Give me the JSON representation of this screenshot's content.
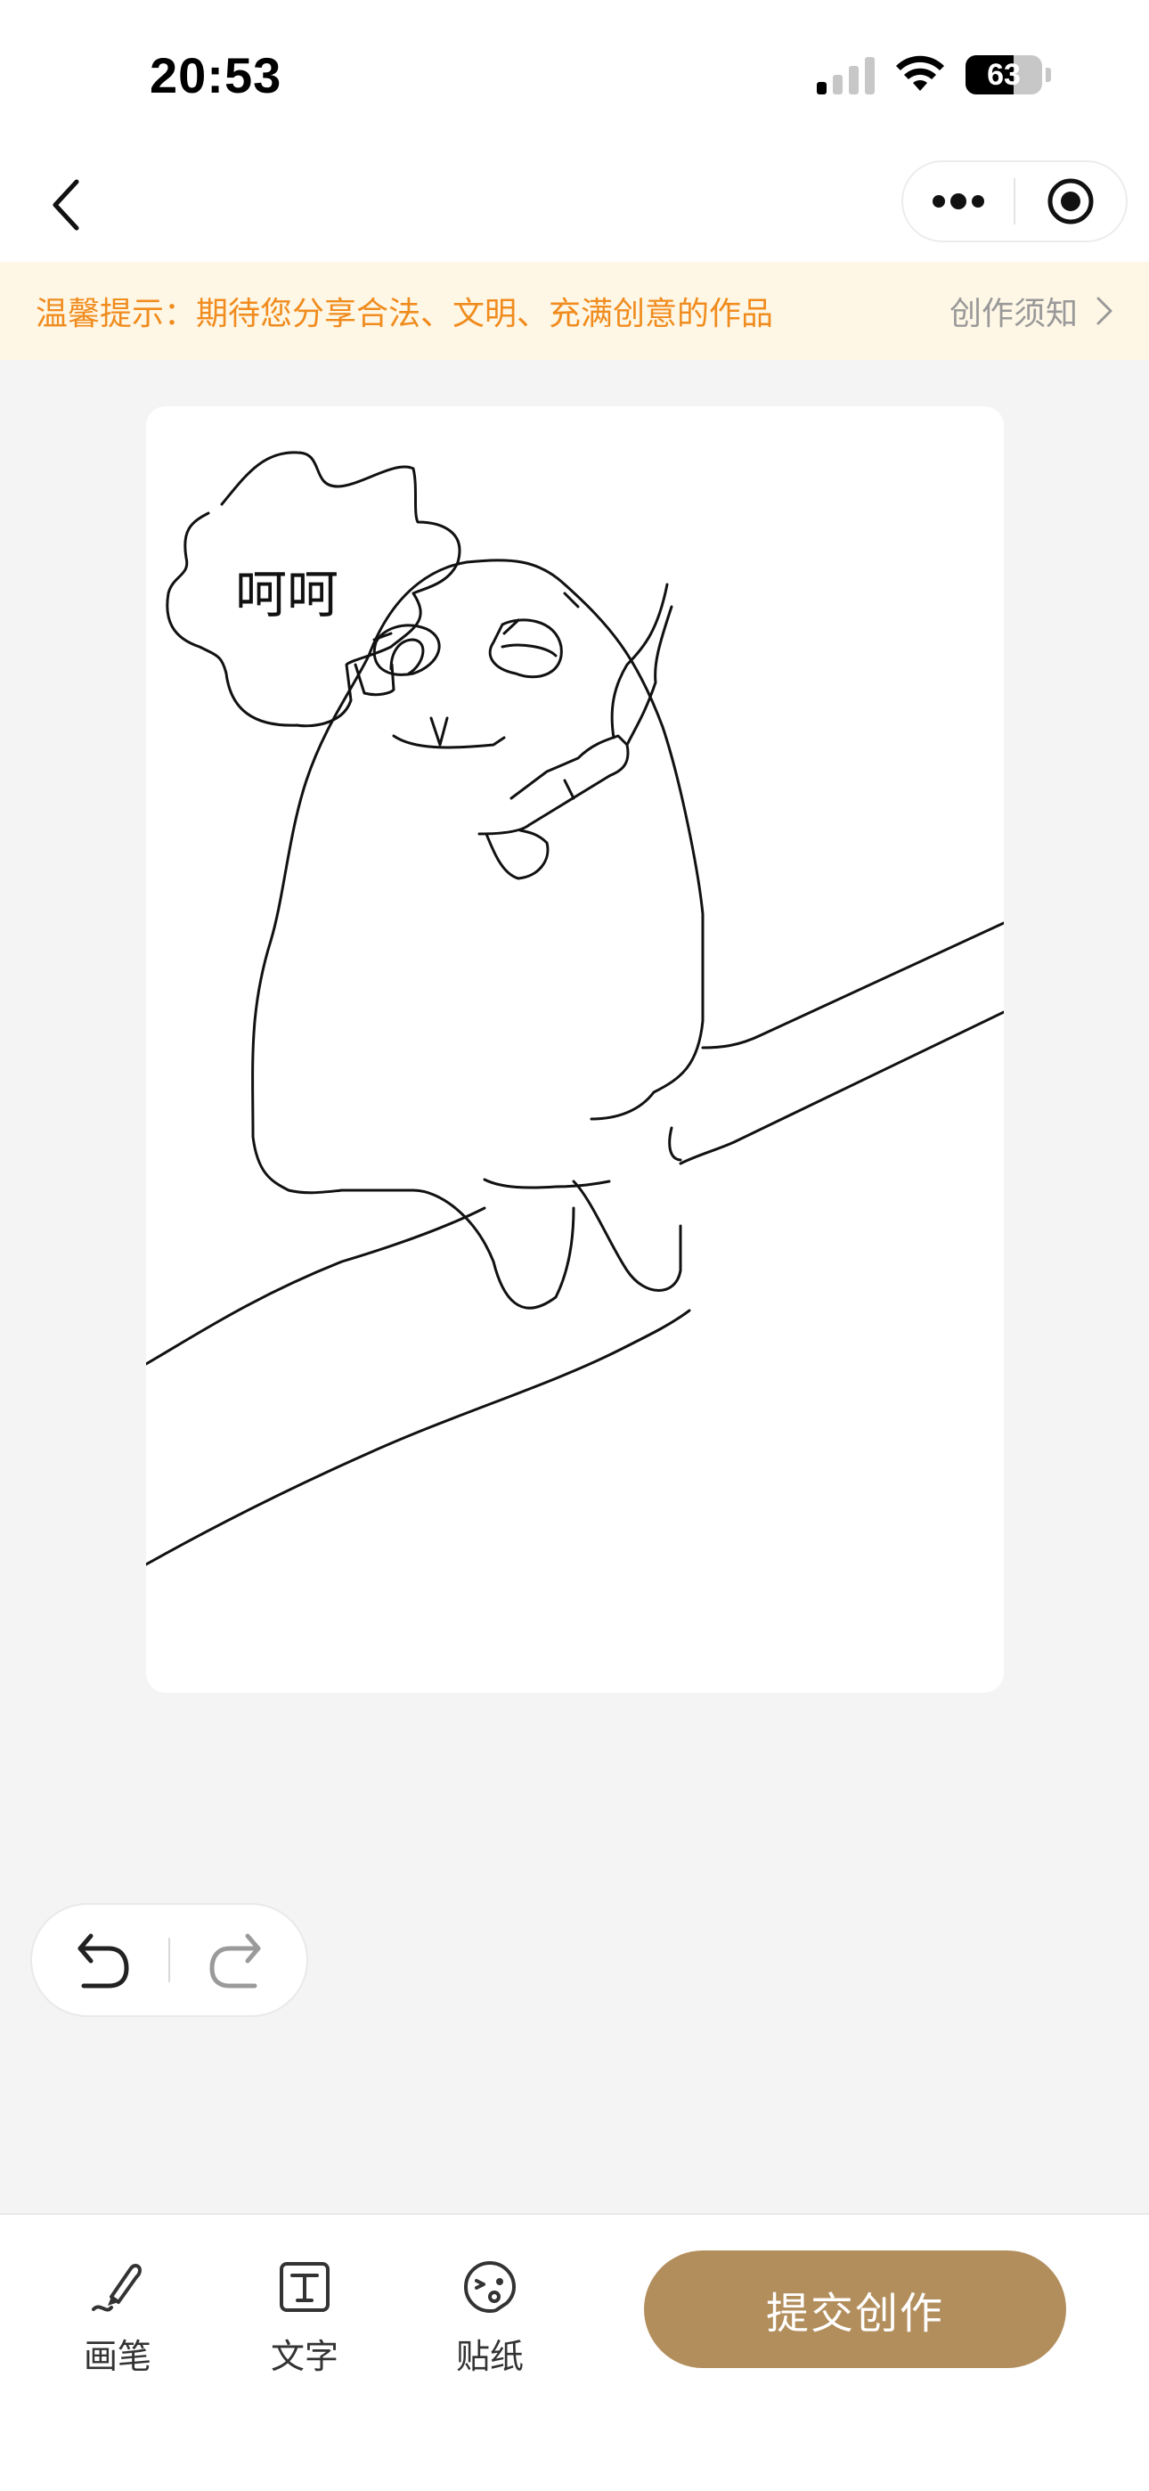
{
  "status_bar": {
    "time": "20:53",
    "battery_level": "63",
    "battery_fraction": 0.63,
    "signal_bars_active": 1,
    "signal_bars_total": 4
  },
  "nav": {
    "back_icon": "chevron-left-icon",
    "more_icon": "more-dots-icon",
    "close_icon": "target-circle-icon"
  },
  "notice": {
    "text": "温馨提示：期待您分享合法、文明、充满创意的作品",
    "link_label": "创作须知",
    "link_icon": "chevron-right-icon"
  },
  "canvas": {
    "bubble_text": "呵呵"
  },
  "history": {
    "undo_icon": "undo-icon",
    "redo_icon": "redo-icon"
  },
  "toolbar": {
    "brush_label": "画笔",
    "text_label": "文字",
    "sticker_label": "贴纸",
    "submit_label": "提交创作"
  },
  "colors": {
    "notice_bg": "#fff7e6",
    "notice_text": "#f08c1e",
    "accent": "#b38e5d",
    "page_bg": "#f4f4f4"
  }
}
